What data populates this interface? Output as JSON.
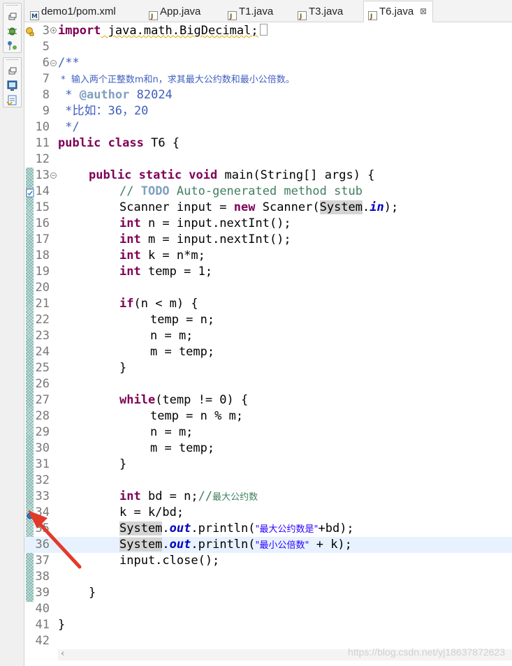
{
  "tabs": [
    {
      "label": "demo1/pom.xml",
      "icon": "maven-pom-icon"
    },
    {
      "label": "App.java",
      "icon": "java-file-icon"
    },
    {
      "label": "T1.java",
      "icon": "java-file-icon"
    },
    {
      "label": "T3.java",
      "icon": "java-file-icon"
    },
    {
      "label": "T6.java",
      "icon": "java-file-icon",
      "active": true,
      "close": "⊠"
    }
  ],
  "toolbar": {
    "icons": [
      "restore-icon",
      "debug-icon",
      "breakpoint-view-icon",
      "restore-icon",
      "console-icon",
      "problems-icon"
    ]
  },
  "editor": {
    "watermark": "https://blog.csdn.net/yj18637872623",
    "lines": [
      {
        "num": "3"
      },
      {
        "num": "5"
      },
      {
        "num": "6"
      },
      {
        "num": "7"
      },
      {
        "num": "8"
      },
      {
        "num": "9"
      },
      {
        "num": "10"
      },
      {
        "num": "11"
      },
      {
        "num": "12"
      },
      {
        "num": "13"
      },
      {
        "num": "14"
      },
      {
        "num": "15"
      },
      {
        "num": "16"
      },
      {
        "num": "17"
      },
      {
        "num": "18"
      },
      {
        "num": "19"
      },
      {
        "num": "20"
      },
      {
        "num": "21"
      },
      {
        "num": "22"
      },
      {
        "num": "23"
      },
      {
        "num": "24"
      },
      {
        "num": "25"
      },
      {
        "num": "26"
      },
      {
        "num": "27"
      },
      {
        "num": "28"
      },
      {
        "num": "29"
      },
      {
        "num": "30"
      },
      {
        "num": "31"
      },
      {
        "num": "32"
      },
      {
        "num": "33"
      },
      {
        "num": "34"
      },
      {
        "num": "35"
      },
      {
        "num": "36"
      },
      {
        "num": "37"
      },
      {
        "num": "38"
      },
      {
        "num": "39"
      },
      {
        "num": "40"
      },
      {
        "num": "41"
      },
      {
        "num": "42"
      }
    ],
    "code": {
      "import_kw": "import",
      "import_pkg": " java.math.BigDecimal;",
      "doc_open": "/**",
      "doc_line1": " *  输入两个正整数m和n，求其最大公约数和最小公倍数。",
      "doc_star": " * ",
      "doc_author_tag": "@author",
      "doc_author_val": " 82024",
      "doc_example": " *比如：36，20",
      "doc_close": " */",
      "cls_public": "public",
      "cls_class": " class",
      "cls_name": " T6 {",
      "main_mods": "public static void",
      "main_sig": " main(String[] args) {",
      "todo_comment_prefix": "// ",
      "todo_tag": "TODO",
      "todo_text": " Auto-generated method stub",
      "l15_a": "Scanner input = ",
      "l15_new": "new",
      "l15_b": " Scanner(",
      "l15_sys": "System",
      "l15_dot": ".",
      "l15_in": "in",
      "l15_c": ");",
      "int_kw": "int",
      "l16": " n = input.nextInt();",
      "l17": " m = input.nextInt();",
      "l18": " k = n*m;",
      "l19": " temp = 1;",
      "if_kw": "if",
      "l21": "(n < m) {",
      "l22": "temp = n;",
      "l23": "n = m;",
      "l24": "m = temp;",
      "close_brace": "}",
      "while_kw": "while",
      "l27": "(temp != 0) {",
      "l28": "temp = n % m;",
      "l29": "n = m;",
      "l30": "m = temp;",
      "l33_code": " bd = n;",
      "l33_cm_prefix": "//",
      "l33_cm": "最大公约数",
      "l34": "k = k/bd;",
      "sys": "System",
      "dot": ".",
      "out": "out",
      "l35_a": ".println(",
      "l35_str": "\"最大公约数是\"",
      "l35_b": "+bd);",
      "l36_str": "\"最小公倍数\"",
      "l36_b": " + k);",
      "l37": "input.close();",
      "l39": "}",
      "l41": "}"
    }
  }
}
